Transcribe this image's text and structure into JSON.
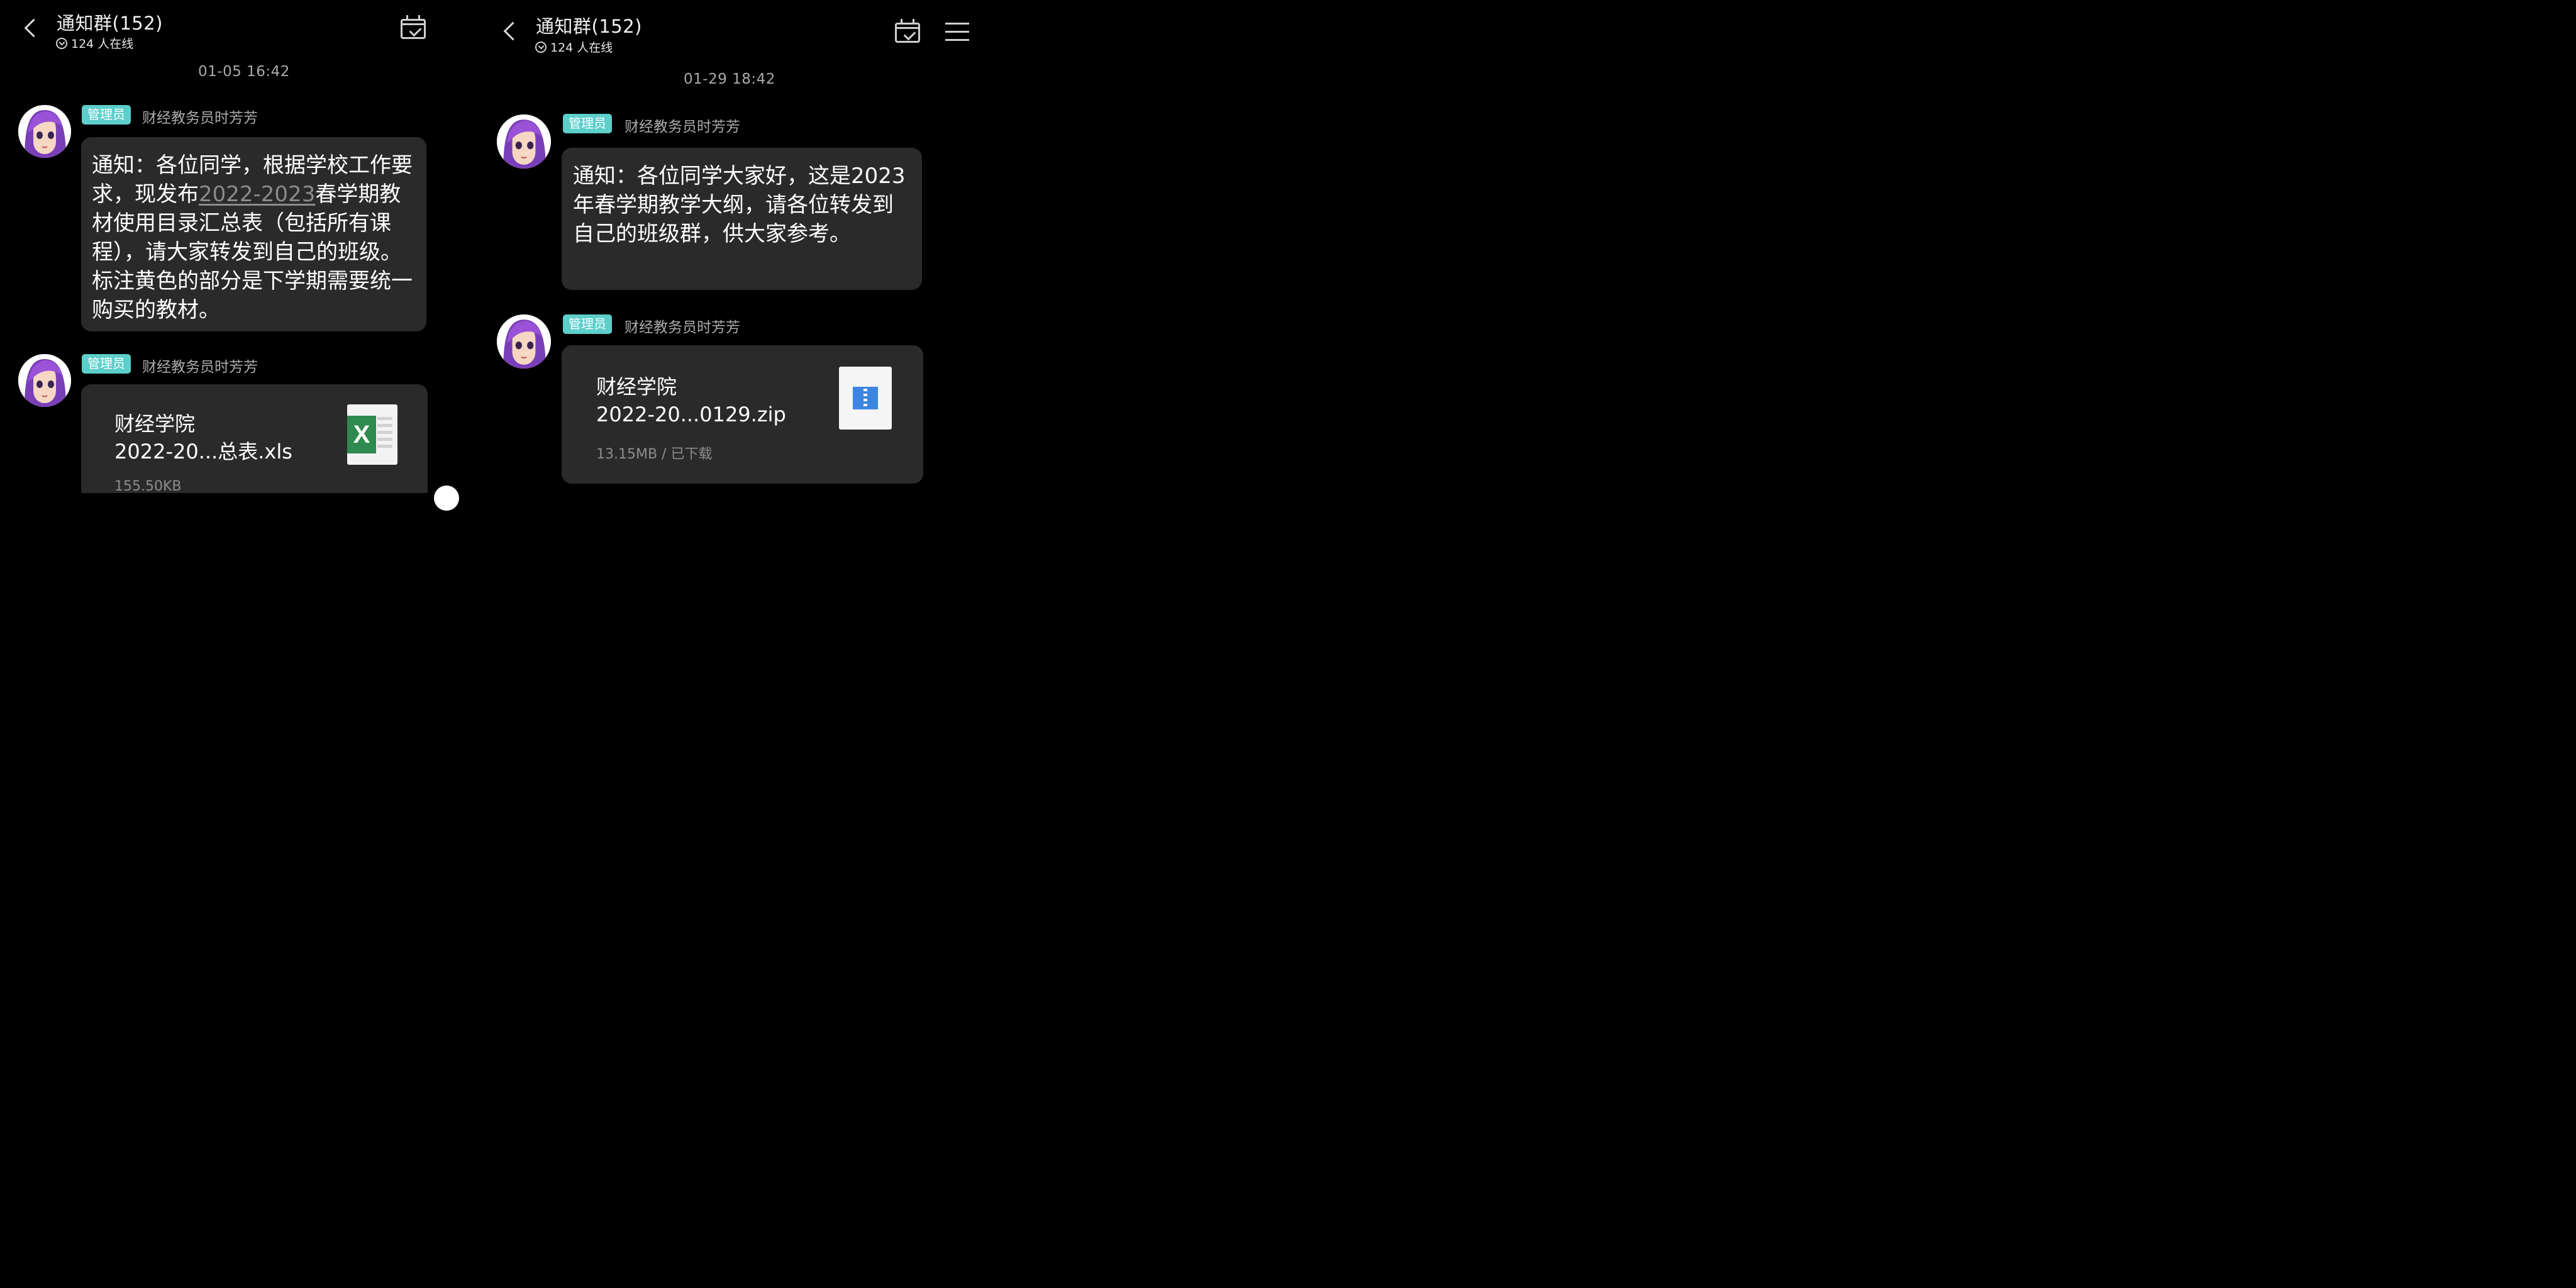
{
  "left": {
    "header": {
      "title": "通知群(152)",
      "online": "124 人在线",
      "back_icon": "chevron-left-icon",
      "calendar_icon": "calendar-check-icon",
      "menu_icon": "hamburger-menu-icon"
    },
    "timestamp": "01-05 16:42",
    "messages": [
      {
        "role": "管理员",
        "sender": "财经教务员时芳芳",
        "text_before": "通知：各位同学，根据学校工作要求，现发布",
        "link": "2022-2023",
        "text_after": "春学期教材使用目录汇总表（包括所有课程），请大家转发到自己的班级。标注黄色的部分是下学期需要统一购买的教材。"
      },
      {
        "role": "管理员",
        "sender": "财经教务员时芳芳",
        "file_name_line1": "财经学院",
        "file_name_line2": "2022-20...总表.xls",
        "file_meta": "155.50KB",
        "file_icon": "excel-file-icon",
        "file_icon_letter": "X"
      }
    ]
  },
  "right": {
    "header": {
      "title": "通知群(152)",
      "online": "124 人在线",
      "back_icon": "chevron-left-icon",
      "calendar_icon": "calendar-check-icon",
      "menu_icon": "hamburger-menu-icon"
    },
    "timestamp": "01-29 18:42",
    "messages": [
      {
        "role": "管理员",
        "sender": "财经教务员时芳芳",
        "text": "通知：各位同学大家好，这是2023年春学期教学大纲，请各位转发到自己的班级群，供大家参考。"
      },
      {
        "role": "管理员",
        "sender": "财经教务员时芳芳",
        "file_name_line1": "财经学院",
        "file_name_line2": "2022-20...0129.zip",
        "file_meta": "13.15MB / 已下载",
        "file_icon": "zip-file-icon"
      }
    ]
  },
  "colors": {
    "background": "#000000",
    "bubble": "#2a2a2a",
    "admin_badge": "#5ccfcb",
    "sender_text": "#ababab",
    "timestamp_text": "#a9a9a9",
    "excel_green": "#2e8a4e",
    "zip_blue": "#3d86e0"
  }
}
